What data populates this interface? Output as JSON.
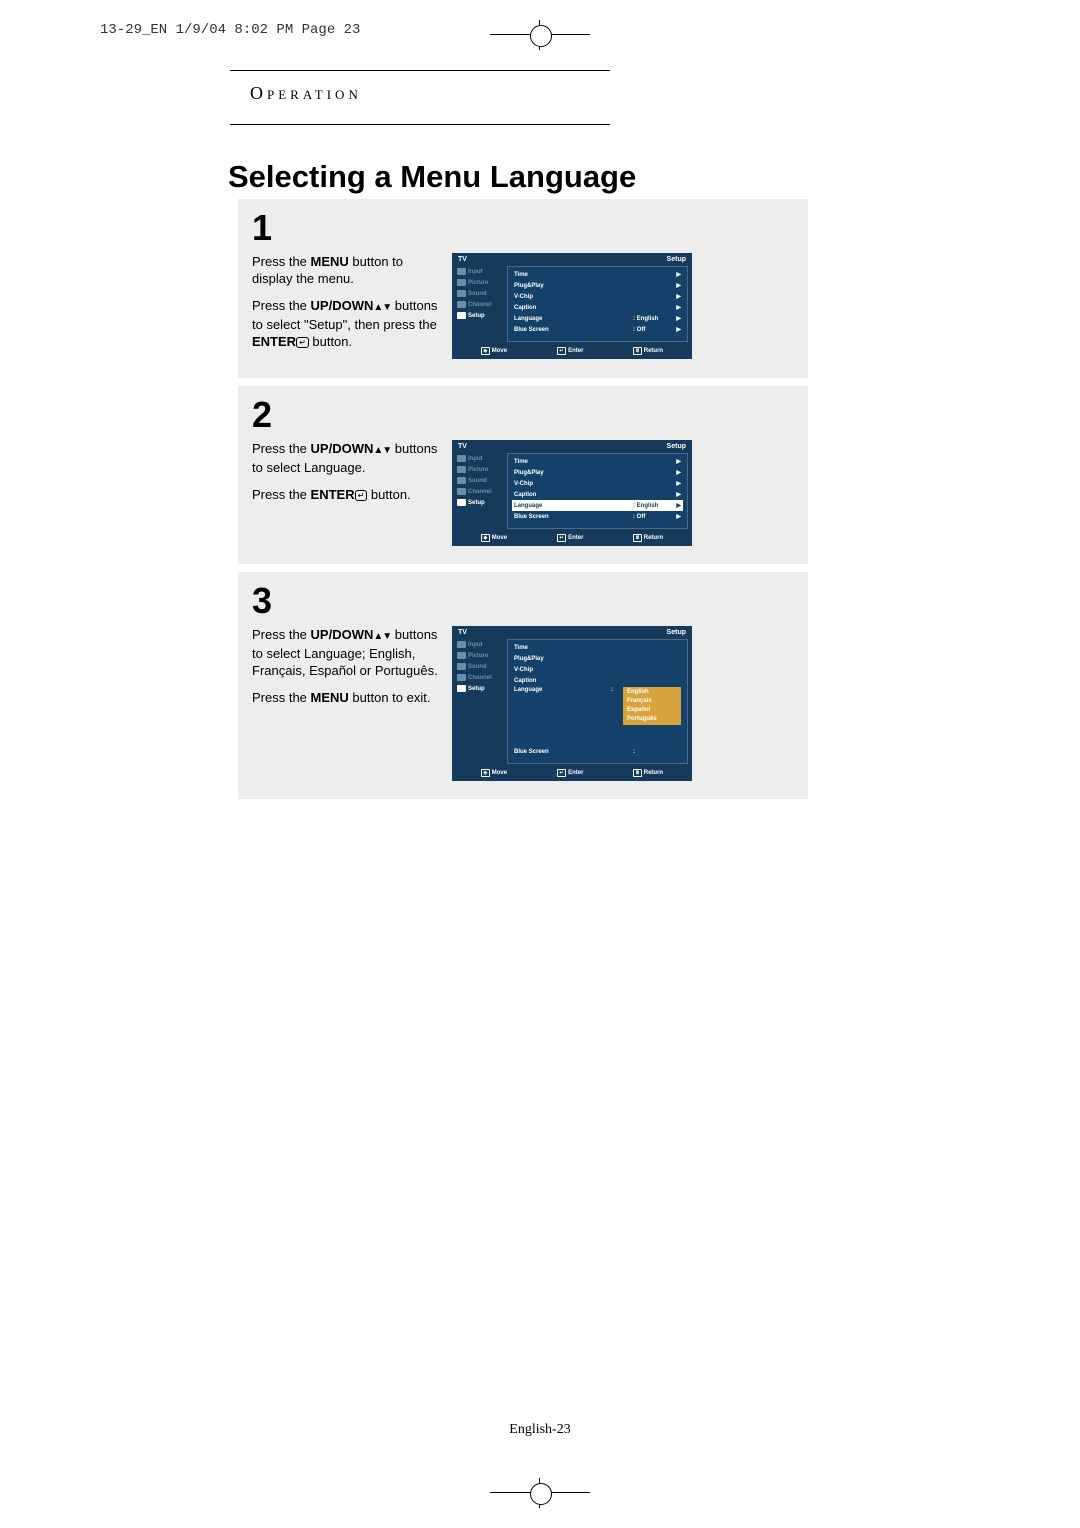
{
  "crop_header": "13-29_EN  1/9/04 8:02 PM  Page 23",
  "section": "Operation",
  "title": "Selecting a Menu Language",
  "page_number_prefix": "English-",
  "page_number": "23",
  "steps": [
    {
      "num": "1",
      "instructions": [
        {
          "parts": [
            "Press the ",
            {
              "b": "MENU"
            },
            " button to display the menu."
          ]
        },
        {
          "parts": [
            "Press the ",
            {
              "b": "UP/DOWN"
            },
            {
              "ud": true
            },
            " buttons to select \"Setup\", then press the ",
            {
              "b": "ENTER"
            },
            {
              "ei": true
            },
            " button."
          ]
        }
      ],
      "osd": {
        "title_left": "TV",
        "title_right": "Setup",
        "side": [
          "Input",
          "Picture",
          "Sound",
          "Channel",
          "Setup"
        ],
        "side_active": 4,
        "rows": [
          {
            "l": "Time",
            "v": "",
            "a": "▶"
          },
          {
            "l": "Plug&Play",
            "v": "",
            "a": "▶"
          },
          {
            "l": "V-Chip",
            "v": "",
            "a": "▶"
          },
          {
            "l": "Caption",
            "v": "",
            "a": "▶"
          },
          {
            "l": "Language",
            "v": ": English",
            "a": "▶"
          },
          {
            "l": "Blue Screen",
            "v": ": Off",
            "a": "▶"
          }
        ],
        "sel_row": -1,
        "dropdown": null,
        "footer": {
          "move": "Move",
          "enter": "Enter",
          "return": "Return"
        }
      }
    },
    {
      "num": "2",
      "instructions": [
        {
          "parts": [
            "Press the ",
            {
              "b": "UP/DOWN"
            },
            {
              "ud": true
            },
            " buttons to select Language."
          ]
        },
        {
          "parts": [
            "Press the ",
            {
              "b": "ENTER"
            },
            {
              "ei": true
            },
            " button."
          ]
        }
      ],
      "osd": {
        "title_left": "TV",
        "title_right": "Setup",
        "side": [
          "Input",
          "Picture",
          "Sound",
          "Channel",
          "Setup"
        ],
        "side_active": 4,
        "rows": [
          {
            "l": "Time",
            "v": "",
            "a": "▶"
          },
          {
            "l": "Plug&Play",
            "v": "",
            "a": "▶"
          },
          {
            "l": "V-Chip",
            "v": "",
            "a": "▶"
          },
          {
            "l": "Caption",
            "v": "",
            "a": "▶"
          },
          {
            "l": "Language",
            "v": ": English",
            "a": "▶"
          },
          {
            "l": "Blue Screen",
            "v": ": Off",
            "a": "▶"
          }
        ],
        "sel_row": 4,
        "dropdown": null,
        "footer": {
          "move": "Move",
          "enter": "Enter",
          "return": "Return"
        }
      }
    },
    {
      "num": "3",
      "instructions": [
        {
          "parts": [
            "Press the ",
            {
              "b": "UP/DOWN"
            },
            {
              "ud": true
            },
            " buttons to select Language; English, Français, Español or Português."
          ]
        },
        {
          "parts": [
            "Press the ",
            {
              "b": "MENU"
            },
            " button to exit."
          ]
        }
      ],
      "osd": {
        "title_left": "TV",
        "title_right": "Setup",
        "side": [
          "Input",
          "Picture",
          "Sound",
          "Channel",
          "Setup"
        ],
        "side_active": 4,
        "rows": [
          {
            "l": "Time",
            "v": "",
            "a": ""
          },
          {
            "l": "Plug&Play",
            "v": "",
            "a": ""
          },
          {
            "l": "V-Chip",
            "v": "",
            "a": ""
          },
          {
            "l": "Caption",
            "v": "",
            "a": ""
          },
          {
            "l": "Language",
            "v": ":",
            "a": "",
            "dd": true
          },
          {
            "l": "Blue Screen",
            "v": ":",
            "a": ""
          }
        ],
        "sel_row": -1,
        "dropdown": [
          "English",
          "Français",
          "Español",
          "Português"
        ],
        "footer": {
          "move": "Move",
          "enter": "Enter",
          "return": "Return"
        }
      }
    }
  ]
}
